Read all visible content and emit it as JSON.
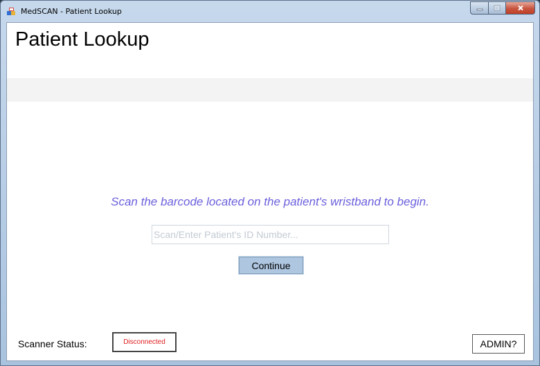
{
  "window": {
    "title": "MedSCAN - Patient Lookup",
    "icon": "app-icon",
    "controls": [
      "minimize-icon",
      "maximize-icon",
      "close-icon"
    ]
  },
  "main": {
    "page_title": "Patient Lookup",
    "instruction": "Scan the barcode located on the patient's wristband to begin.",
    "id_input": {
      "value": "",
      "placeholder": "Scan/Enter Patient's ID Number..."
    },
    "continue_label": "Continue"
  },
  "footer": {
    "scanner_status_label": "Scanner Status:",
    "scanner_status_value": "Disconnected",
    "admin_label": "ADMIN?"
  },
  "colors": {
    "instruction_text": "#6a5fdc",
    "status_disconnected": "#e02020",
    "continue_button": "#aec6e0"
  }
}
